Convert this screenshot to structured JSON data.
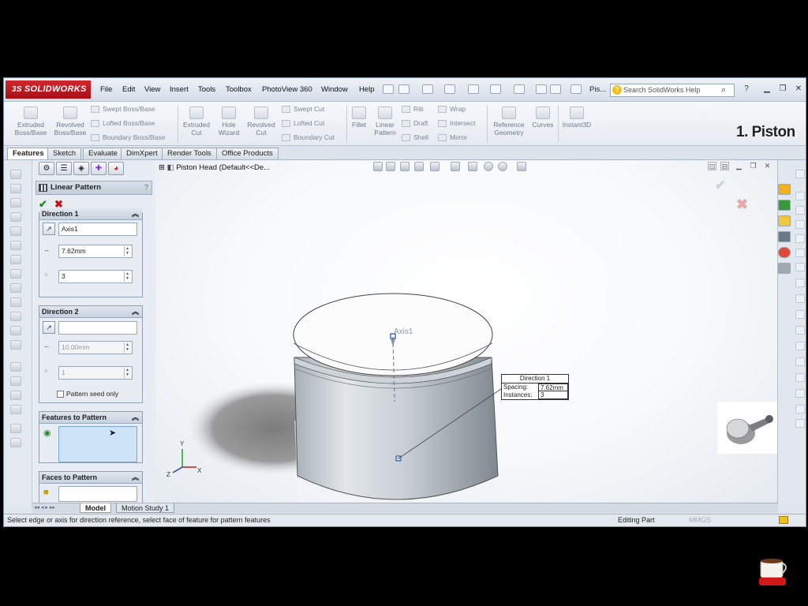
{
  "app": {
    "logo_text": "SOLIDWORKS",
    "logo_prefix": "3S"
  },
  "menu": [
    "File",
    "Edit",
    "View",
    "Insert",
    "Tools",
    "Toolbox",
    "PhotoView 360",
    "Window",
    "Help"
  ],
  "doc_title": "Pis...",
  "help_search": {
    "placeholder": "Search SolidWorks Help"
  },
  "overlay_label": "1. Piston",
  "commands": {
    "extruded_boss": "Extruded Boss/Base",
    "revolved_boss": "Revolved Boss/Base",
    "swept_boss": "Swept Boss/Base",
    "lofted_boss": "Lofted Boss/Base",
    "boundary_boss": "Boundary Boss/Base",
    "extruded_cut": "Extruded Cut",
    "hole_wizard": "Hole Wizard",
    "revolved_cut": "Revolved Cut",
    "swept_cut": "Swept Cut",
    "lofted_cut": "Lofted Cut",
    "boundary_cut": "Boundary Cut",
    "fillet": "Fillet",
    "linear_pattern": "Linear Pattern",
    "rib": "Rib",
    "draft": "Draft",
    "shell": "Shell",
    "wrap": "Wrap",
    "intersect": "Intersect",
    "mirror": "Mirror",
    "reference_geometry": "Reference Geometry",
    "curves": "Curves",
    "instant3d": "Instant3D"
  },
  "cmd_tabs": [
    "Features",
    "Sketch",
    "Evaluate",
    "DimXpert",
    "Render Tools",
    "Office Products"
  ],
  "property_manager": {
    "title": "Linear Pattern",
    "help": "?",
    "direction1": {
      "label": "Direction 1",
      "reference": "Axis1",
      "spacing": "7.62mm",
      "instances": "3"
    },
    "direction2": {
      "label": "Direction 2",
      "reference": "",
      "spacing": "10.00mm",
      "instances": "1",
      "seed_only_label": "Pattern seed only"
    },
    "features_to_pattern": {
      "label": "Features to Pattern"
    },
    "faces_to_pattern": {
      "label": "Faces to Pattern"
    }
  },
  "graphics": {
    "tree_root": "Piston Head  (Default<<De...",
    "axis_label": "Axis1",
    "callout": {
      "header": "Direction 1",
      "spacing_label": "Spacing:",
      "spacing_value": "7.62mm",
      "instances_label": "Instances:",
      "instances_value": "3"
    },
    "triad": {
      "x": "X",
      "y": "Y",
      "z": "Z"
    }
  },
  "bottom_tabs": [
    "Model",
    "Motion Study 1"
  ],
  "status": {
    "message": "Select edge or axis for direction reference, select face of feature for pattern features",
    "mode": "Editing Part",
    "units": "MMGS"
  },
  "colors": {
    "brand_red": "#c0141e",
    "ok_green": "#1e8f1e",
    "cancel_red": "#c01818",
    "selection_blue": "#cfe3f6"
  }
}
